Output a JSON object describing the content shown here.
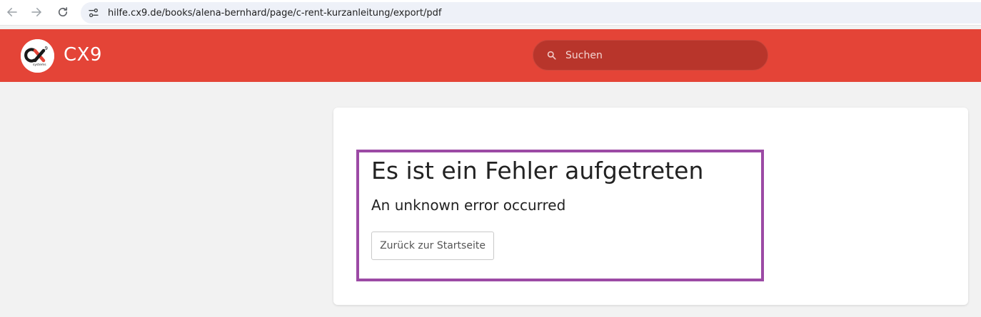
{
  "browser": {
    "url": "hilfe.cx9.de/books/alena-bernhard/page/c-rent-kurzanleitung/export/pdf",
    "icons": [
      "back-arrow-icon",
      "forward-arrow-icon",
      "reload-icon",
      "site-info-icon"
    ]
  },
  "header": {
    "title": "CX9",
    "brand_color": "#e44437",
    "search": {
      "placeholder": "Suchen",
      "value": ""
    }
  },
  "error": {
    "title": "Es ist ein Fehler aufgetreten",
    "message": "An unknown error occurred",
    "home_button_label": "Zurück zur Startseite",
    "highlight_color": "#9c4aa5"
  }
}
